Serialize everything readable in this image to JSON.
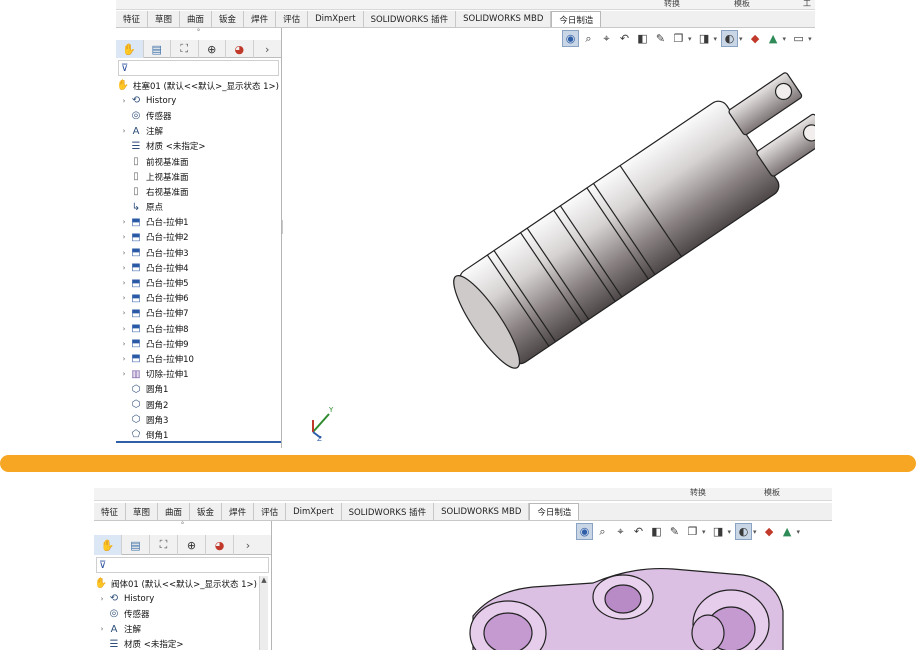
{
  "window1": {
    "top_labels": [
      "转换",
      "模板",
      "工"
    ],
    "tabs": [
      {
        "label": "特征",
        "active": false
      },
      {
        "label": "草图",
        "active": false
      },
      {
        "label": "曲面",
        "active": false
      },
      {
        "label": "钣金",
        "active": false
      },
      {
        "label": "焊件",
        "active": false
      },
      {
        "label": "评估",
        "active": false
      },
      {
        "label": "DimXpert",
        "active": false
      },
      {
        "label": "SOLIDWORKS 插件",
        "active": false
      },
      {
        "label": "SOLIDWORKS MBD",
        "active": false
      },
      {
        "label": "今日制造",
        "active": true
      }
    ],
    "panel_tab_icons": [
      "feature-manager-icon",
      "property-manager-icon",
      "configuration-manager-icon",
      "dimxpert-icon",
      "display-manager-icon"
    ],
    "panel_more_icon": "chevron-right-icon",
    "filter_icon": "filter-icon",
    "tree": [
      {
        "label": "柱塞01 (默认<<默认>_显示状态 1>)",
        "icon": "part-icon",
        "expand": false,
        "root": true
      },
      {
        "label": "History",
        "icon": "history-icon",
        "expand": true
      },
      {
        "label": "传感器",
        "icon": "sensor-icon",
        "expand": false
      },
      {
        "label": "注解",
        "icon": "annotation-icon",
        "expand": true
      },
      {
        "label": "材质 <未指定>",
        "icon": "material-icon",
        "expand": false
      },
      {
        "label": "前视基准面",
        "icon": "plane-icon",
        "expand": false
      },
      {
        "label": "上视基准面",
        "icon": "plane-icon",
        "expand": false
      },
      {
        "label": "右视基准面",
        "icon": "plane-icon",
        "expand": false
      },
      {
        "label": "原点",
        "icon": "origin-icon",
        "expand": false
      },
      {
        "label": "凸台-拉伸1",
        "icon": "extrude-icon",
        "expand": true
      },
      {
        "label": "凸台-拉伸2",
        "icon": "extrude-icon",
        "expand": true
      },
      {
        "label": "凸台-拉伸3",
        "icon": "extrude-icon",
        "expand": true
      },
      {
        "label": "凸台-拉伸4",
        "icon": "extrude-icon",
        "expand": true
      },
      {
        "label": "凸台-拉伸5",
        "icon": "extrude-icon",
        "expand": true
      },
      {
        "label": "凸台-拉伸6",
        "icon": "extrude-icon",
        "expand": true
      },
      {
        "label": "凸台-拉伸7",
        "icon": "extrude-icon",
        "expand": true
      },
      {
        "label": "凸台-拉伸8",
        "icon": "extrude-icon",
        "expand": true
      },
      {
        "label": "凸台-拉伸9",
        "icon": "extrude-icon",
        "expand": true
      },
      {
        "label": "凸台-拉伸10",
        "icon": "extrude-icon",
        "expand": true
      },
      {
        "label": "切除-拉伸1",
        "icon": "cut-extrude-icon",
        "expand": true
      },
      {
        "label": "圆角1",
        "icon": "fillet-icon",
        "expand": false
      },
      {
        "label": "圆角2",
        "icon": "fillet-icon",
        "expand": false
      },
      {
        "label": "圆角3",
        "icon": "fillet-icon",
        "expand": false
      },
      {
        "label": "倒角1",
        "icon": "chamfer-icon",
        "expand": false
      }
    ],
    "triad": {
      "y_label": "Y",
      "z_label": "Z"
    }
  },
  "window2": {
    "top_labels": [
      "转换",
      "模板"
    ],
    "tabs": [
      {
        "label": "特征",
        "active": false
      },
      {
        "label": "草图",
        "active": false
      },
      {
        "label": "曲面",
        "active": false
      },
      {
        "label": "钣金",
        "active": false
      },
      {
        "label": "焊件",
        "active": false
      },
      {
        "label": "评估",
        "active": false
      },
      {
        "label": "DimXpert",
        "active": false
      },
      {
        "label": "SOLIDWORKS 插件",
        "active": false
      },
      {
        "label": "SOLIDWORKS MBD",
        "active": false
      },
      {
        "label": "今日制造",
        "active": true
      }
    ],
    "tree": [
      {
        "label": "阀体01 (默认<<默认>_显示状态 1>)",
        "icon": "part-icon",
        "expand": false,
        "root": true
      },
      {
        "label": "History",
        "icon": "history-icon",
        "expand": true
      },
      {
        "label": "传感器",
        "icon": "sensor-icon",
        "expand": false
      },
      {
        "label": "注解",
        "icon": "annotation-icon",
        "expand": true
      },
      {
        "label": "材质 <未指定>",
        "icon": "material-icon",
        "expand": false
      }
    ]
  },
  "view_toolbar_icons": [
    "view-orientation-icon",
    "zoom-to-fit-icon",
    "zoom-area-icon",
    "previous-view-icon",
    "section-view-icon",
    "dynamic-annotation-icon",
    "view-settings-icon",
    "display-style-icon",
    "hide-show-icon",
    "edit-appearance-icon",
    "apply-scene-icon",
    "view-monitor-icon"
  ],
  "colors": {
    "divider": "#f6a623",
    "part1": "#b0a9a9",
    "part2": "#e2c6e9",
    "accent": "#2f5fa8"
  }
}
